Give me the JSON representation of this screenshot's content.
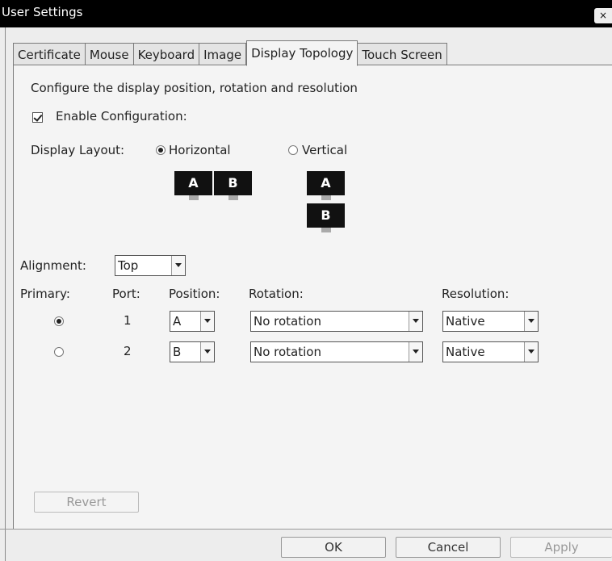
{
  "window": {
    "title": "User Settings",
    "close_glyph": "×"
  },
  "tabs": [
    {
      "label": "Certificate",
      "active": false
    },
    {
      "label": "Mouse",
      "active": false
    },
    {
      "label": "Keyboard",
      "active": false
    },
    {
      "label": "Image",
      "active": false
    },
    {
      "label": "Display Topology",
      "active": true
    },
    {
      "label": "Touch Screen",
      "active": false
    }
  ],
  "panel": {
    "description": "Configure the display position, rotation and resolution",
    "enable_label": "Enable Configuration:",
    "enable_checked": true,
    "layout_label": "Display Layout:",
    "layout_horizontal": "Horizontal",
    "layout_vertical": "Vertical",
    "layout_selected": "Horizontal",
    "monitor_a": "A",
    "monitor_b": "B",
    "alignment_label": "Alignment:",
    "alignment_value": "Top",
    "headers": {
      "primary": "Primary:",
      "port": "Port:",
      "position": "Position:",
      "rotation": "Rotation:",
      "resolution": "Resolution:"
    },
    "rows": [
      {
        "primary": true,
        "port": "1",
        "position": "A",
        "rotation": "No rotation",
        "resolution": "Native"
      },
      {
        "primary": false,
        "port": "2",
        "position": "B",
        "rotation": "No rotation",
        "resolution": "Native"
      }
    ],
    "revert_label": "Revert"
  },
  "footer": {
    "ok_label": "OK",
    "cancel_label": "Cancel",
    "apply_label": "Apply"
  },
  "colors": {
    "titlebar": "#000000",
    "panel_bg": "#f4f4f4",
    "monitor": "#111111"
  },
  "icons": [
    "close-icon",
    "checkbox-checked-icon",
    "radio-icon",
    "monitor-icon",
    "dropdown-arrow-icon"
  ]
}
